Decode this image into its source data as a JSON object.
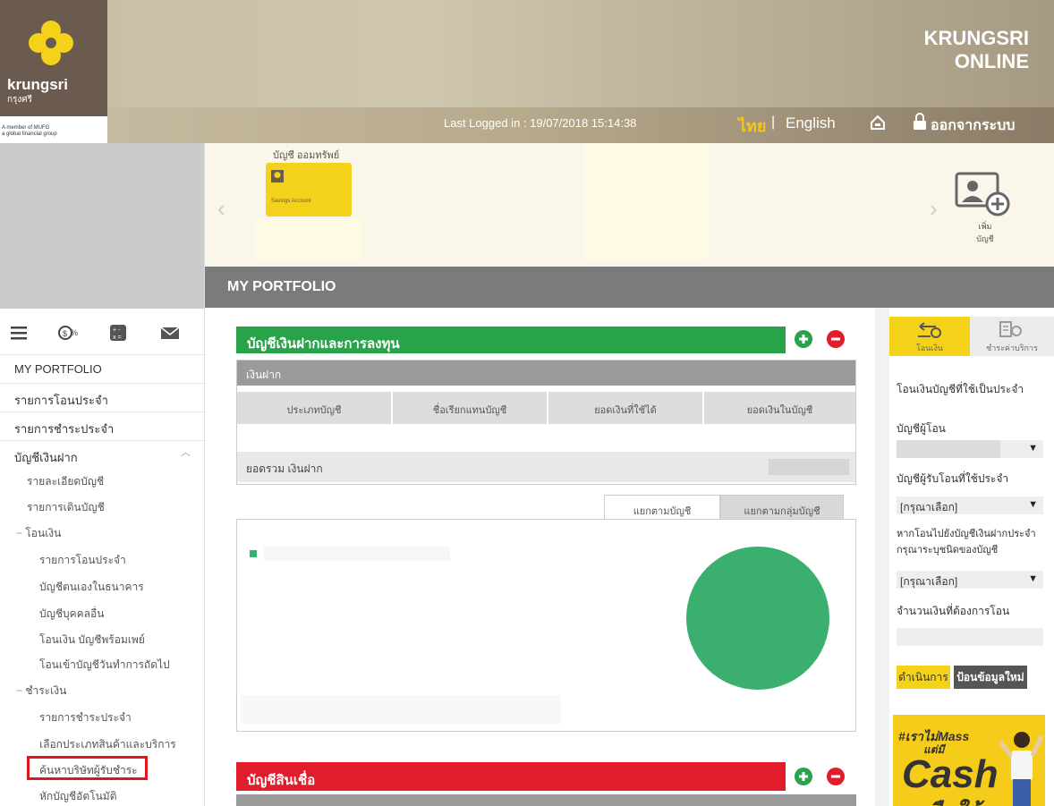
{
  "header": {
    "logo_text": "krungsri",
    "logo_thai": "กรุงศรี",
    "member_line1": "A member of MUFG",
    "member_line2": "a global financial group",
    "brand_line1": "KRUNGSRI",
    "brand_line2": "ONLINE",
    "last_logged": "Last Logged in : 19/07/2018 15:14:38",
    "lang_thai": "ไทย",
    "lang_sep": "|",
    "lang_eng": "English",
    "logout": "ออกจากระบบ"
  },
  "accounts": {
    "title": "บัญชี ออมทรัพย์",
    "card_label": "Savings Account",
    "add_label": "เพิ่ม บัญชี"
  },
  "portfolio": {
    "title": "MY PORTFOLIO"
  },
  "deposit": {
    "title": "บัญชีเงินฝากและการลงทุน",
    "panel_head": "เงินฝาก",
    "columns": [
      "ประเภทบัญชี",
      "ชื่อเรียกแทนบัญชี",
      "ยอดเงินที่ใช้ได้",
      "ยอดเงินในบัญชี"
    ],
    "total_label": "ยอดรวม เงินฝาก"
  },
  "chart_tabs": {
    "by_account": "แยกตามบัญชี",
    "by_group": "แยกตามกลุ่มบัญชี"
  },
  "loan": {
    "title": "บัญชีสินเชื่อ"
  },
  "sidebar": {
    "items": [
      {
        "label": "MY PORTFOLIO"
      },
      {
        "label": "รายการโอนประจำ"
      },
      {
        "label": "รายการชำระประจำ"
      },
      {
        "label": "บัญชีเงินฝาก"
      }
    ],
    "sub_deposit": [
      "รายละเอียดบัญชี",
      "รายการเดินบัญชี"
    ],
    "transfer_group": "โอนเงิน",
    "transfer_items": [
      "รายการโอนประจำ",
      "บัญชีตนเองในธนาคาร",
      "บัญชีบุคคลอื่น",
      "โอนเงิน บัญชีพร้อมเพย์",
      "โอนเข้าบัญชีวันทำการถัดไป"
    ],
    "pay_group": "ชำระเงิน",
    "pay_items": [
      "รายการชำระประจำ",
      "เลือกประเภทสินค้าและบริการ",
      "ค้นหาบริษัทผู้รับชำระ",
      "หักบัญชีอัตโนมัติ"
    ]
  },
  "right_panel": {
    "tab_transfer": "โอนเงิน",
    "tab_pay": "ชำระค่าบริการ",
    "heading": "โอนเงินบัญชีที่ใช้เป็นประจำ",
    "from_label": "บัญชีผู้โอน",
    "to_label": "บัญชีผู้รับโอนที่ใช้ประจำ",
    "select_placeholder": "[กรุณาเลือก]",
    "note_line1": "หากโอนไปยังบัญชีเงินฝากประจำ",
    "note_line2": "กรุณาระบุชนิดของบัญชี",
    "amount_label": "จำนวนเงินที่ต้องการโอน",
    "btn_go": "ดำเนินการ",
    "btn_reset": "ป้อนข้อมูลใหม่",
    "ad_line1": "#เราไม่Mass",
    "ad_line2": "แต่มี",
    "ad_line3": "Cash",
    "ad_line4": "คืนให้"
  },
  "chart_data": {
    "type": "pie",
    "values": [
      100
    ],
    "colors": [
      "#3aaf6f"
    ]
  },
  "colors": {
    "green": "#29a34a",
    "red": "#e11d2b",
    "yellow": "#f5d21a",
    "brown": "#6b5b4f"
  }
}
